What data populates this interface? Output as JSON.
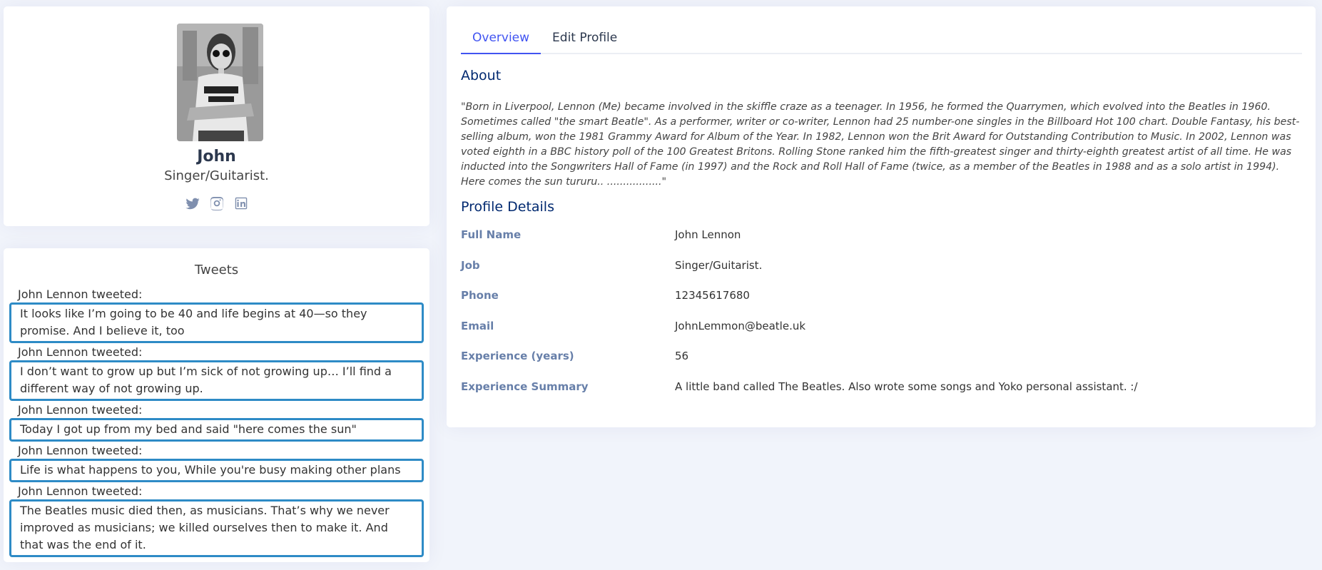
{
  "profile": {
    "name": "John",
    "job": "Singer/Guitarist.",
    "social": [
      "twitter-icon",
      "instagram-icon",
      "linkedin-icon"
    ]
  },
  "tweets": {
    "title": "Tweets",
    "items": [
      {
        "author": "John Lennon tweeted:",
        "text": "It looks like I’m going to be 40 and life begins at 40—so they promise. And I believe it, too"
      },
      {
        "author": "John Lennon tweeted:",
        "text": "I don’t want to grow up but I’m sick of not growing up… I’ll find a different way of not growing up."
      },
      {
        "author": "John Lennon tweeted:",
        "text": "Today I got up from my bed and said \"here comes the sun\""
      },
      {
        "author": "John Lennon tweeted:",
        "text": "Life is what happens to you, While you're busy making other plans"
      },
      {
        "author": "John Lennon tweeted:",
        "text": "The Beatles music died then, as musicians. That’s why we never improved as musicians; we killed ourselves then to make it. And that was the end of it."
      }
    ]
  },
  "tabs": [
    {
      "label": "Overview",
      "active": true
    },
    {
      "label": "Edit Profile",
      "active": false
    }
  ],
  "about": {
    "title": "About",
    "text": "\"Born in Liverpool, Lennon (Me) became involved in the skiffle craze as a teenager. In 1956, he formed the Quarrymen, which evolved into the Beatles in 1960. Sometimes called \"the smart Beatle\". As a performer, writer or co-writer, Lennon had 25 number-one singles in the Billboard Hot 100 chart. Double Fantasy, his best-selling album, won the 1981 Grammy Award for Album of the Year. In 1982, Lennon won the Brit Award for Outstanding Contribution to Music. In 2002, Lennon was voted eighth in a BBC history poll of the 100 Greatest Britons. Rolling Stone ranked him the fifth-greatest singer and thirty-eighth greatest artist of all time. He was inducted into the Songwriters Hall of Fame (in 1997) and the Rock and Roll Hall of Fame (twice, as a member of the Beatles in 1988 and as a solo artist in 1994). Here comes the sun tururu.. .................\""
  },
  "details": {
    "title": "Profile Details",
    "rows": [
      {
        "label": "Full Name",
        "value": "John Lennon"
      },
      {
        "label": "Job",
        "value": "Singer/Guitarist."
      },
      {
        "label": "Phone",
        "value": "12345617680"
      },
      {
        "label": "Email",
        "value": "JohnLemmon@beatle.uk"
      },
      {
        "label": "Experience (years)",
        "value": "56"
      },
      {
        "label": "Experience Summary",
        "value": "A little band called The Beatles. Also wrote some songs and Yoko personal assistant. :/"
      }
    ]
  }
}
